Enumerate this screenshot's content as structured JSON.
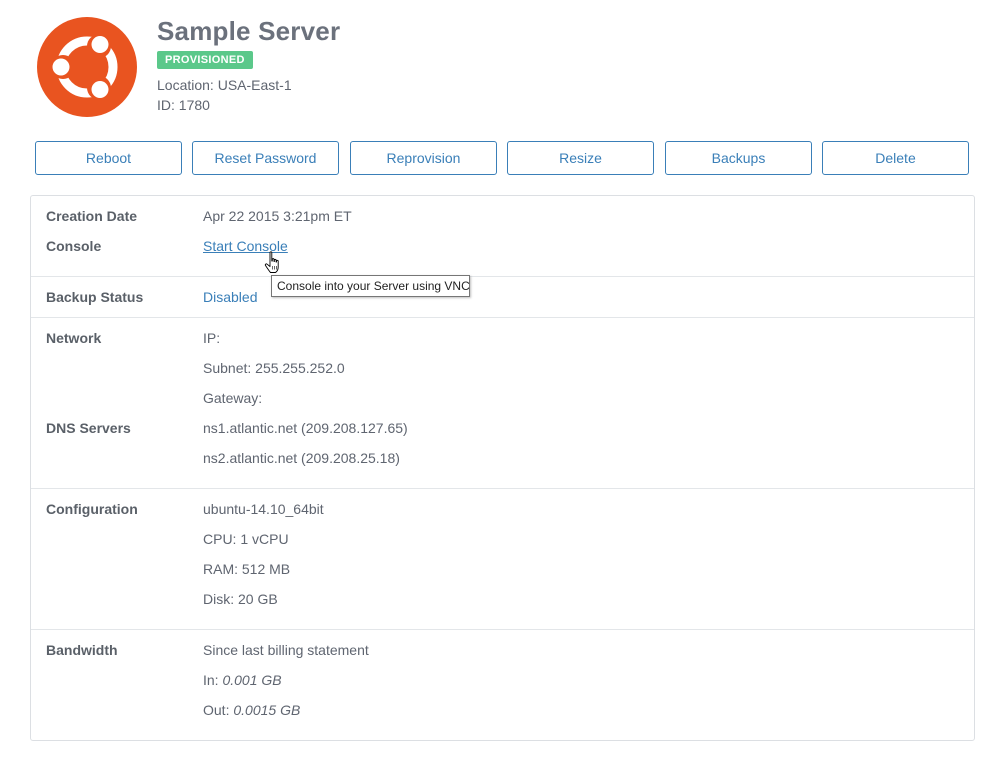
{
  "server": {
    "name": "Sample Server",
    "status": "PROVISIONED",
    "location": "Location: USA-East-1",
    "id": "ID: 1780",
    "logo_icon": "ubuntu-logo-icon",
    "logo_color": "#e95420"
  },
  "actions": [
    "Reboot",
    "Reset Password",
    "Reprovision",
    "Resize",
    "Backups",
    "Delete"
  ],
  "details": {
    "creation_date": {
      "label": "Creation Date",
      "value": "Apr 22 2015 3:21pm ET"
    },
    "console": {
      "label": "Console",
      "link": "Start Console",
      "tooltip": "Console into your Server using VNC"
    },
    "backup": {
      "label": "Backup Status",
      "value": "Disabled"
    },
    "network": {
      "label": "Network",
      "ip": "IP:",
      "subnet": "Subnet: 255.255.252.0",
      "gateway": "Gateway:"
    },
    "dns": {
      "label": "DNS Servers",
      "ns1": "ns1.atlantic.net (209.208.127.65)",
      "ns2": "ns2.atlantic.net (209.208.25.18)"
    },
    "configuration": {
      "label": "Configuration",
      "os": "ubuntu-14.10_64bit",
      "cpu": "CPU: 1 vCPU",
      "ram": "RAM: 512 MB",
      "disk": "Disk: 20 GB"
    },
    "bandwidth": {
      "label": "Bandwidth",
      "since": "Since last billing statement",
      "in_label": "In:",
      "in_value": "0.001 GB",
      "out_label": "Out:",
      "out_value": "0.0015 GB"
    }
  },
  "colors": {
    "accent": "#3a7fb8",
    "badge": "#5bc88a",
    "border": "#dcdfe3"
  },
  "cursor_icon": "hand-pointer-icon"
}
